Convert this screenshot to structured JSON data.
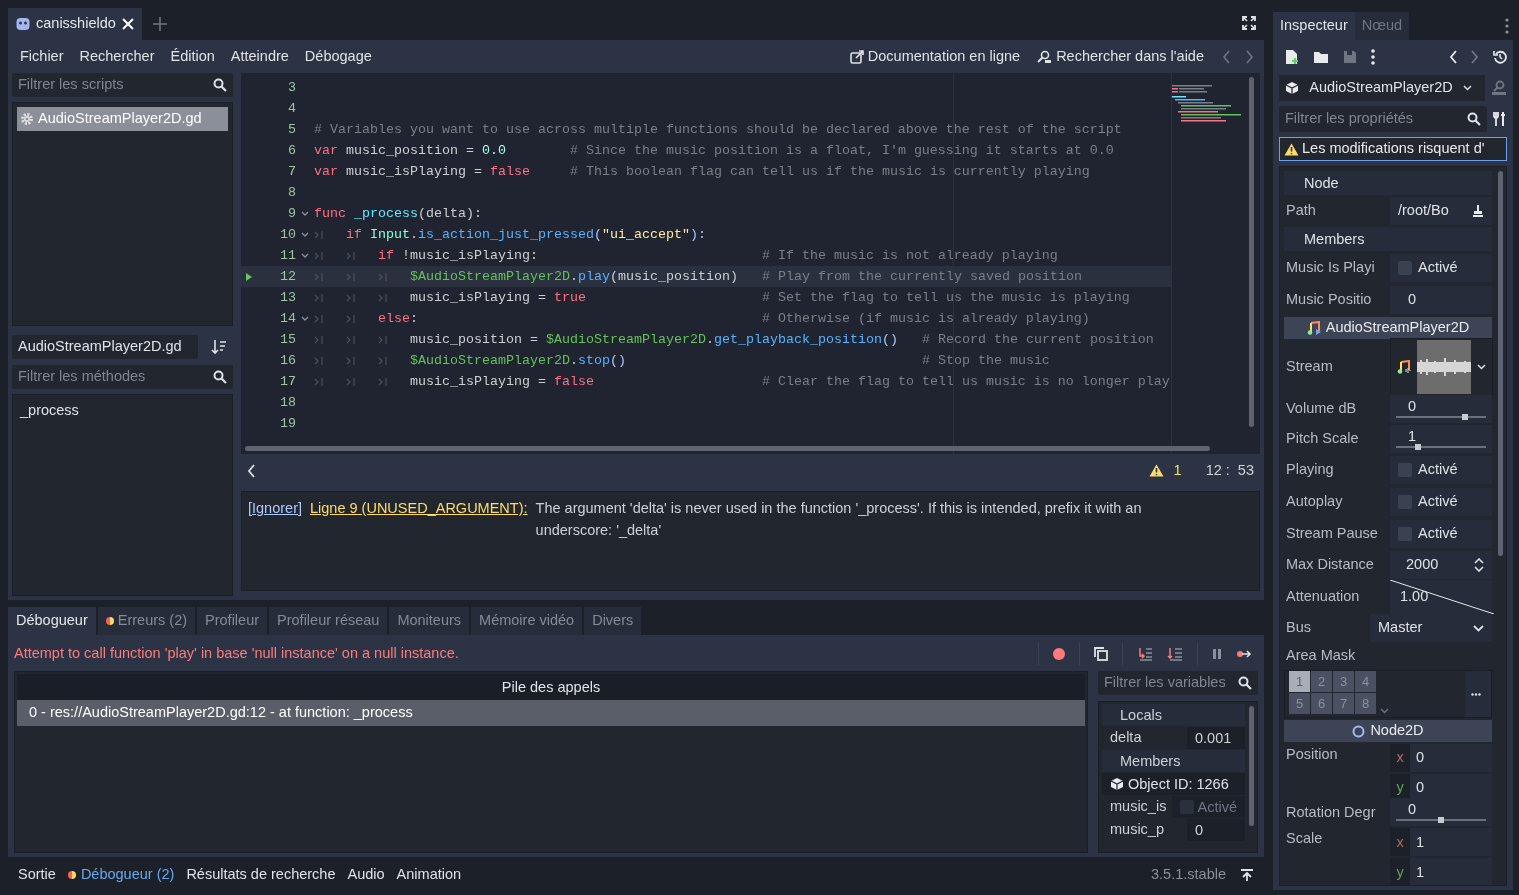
{
  "editor_tabs": [
    {
      "label": "canisshieldo",
      "selected": true
    }
  ],
  "menu": [
    "Fichier",
    "Rechercher",
    "Édition",
    "Atteindre",
    "Débogage"
  ],
  "help_links": [
    "Documentation en ligne",
    "Rechercher dans l'aide"
  ],
  "scripts": {
    "filter_placeholder": "Filtrer les scripts",
    "items": [
      {
        "label": "AudioStreamPlayer2D.gd",
        "selected": true
      }
    ]
  },
  "methods": {
    "script_name": "AudioStreamPlayer2D.gd",
    "filter_placeholder": "Filtrer les méthodes",
    "items": [
      {
        "label": "_process",
        "selected": false
      }
    ]
  },
  "code": {
    "lines": [
      {
        "number": "3",
        "foldable": false,
        "current": false
      },
      {
        "number": "4",
        "foldable": false,
        "current": false
      },
      {
        "number": "5",
        "foldable": false,
        "current": false,
        "tokens": [
          {
            "kind": "comment",
            "text": "# Variables you want to use across multiple functions should be declared above the rest of the script"
          }
        ]
      },
      {
        "number": "6",
        "foldable": false,
        "current": false,
        "tokens": [
          {
            "kind": "keyword",
            "text": "var"
          },
          {
            "kind": "plain",
            "text": " music_position = "
          },
          {
            "kind": "number",
            "text": "0.0"
          },
          {
            "kind": "comment",
            "text": "        # Since the music position is a float, I'm guessing it starts at 0.0"
          }
        ]
      },
      {
        "number": "7",
        "foldable": false,
        "current": false,
        "tokens": [
          {
            "kind": "keyword",
            "text": "var"
          },
          {
            "kind": "plain",
            "text": " music_isPlaying = "
          },
          {
            "kind": "keyword",
            "text": "false"
          },
          {
            "kind": "comment",
            "text": "     # This boolean flag can tell us if the music is currently playing"
          }
        ]
      },
      {
        "number": "8",
        "foldable": false,
        "current": false
      },
      {
        "number": "9",
        "foldable": true,
        "current": false,
        "tokens": [
          {
            "kind": "keyword",
            "text": "func"
          },
          {
            "kind": "define",
            "text": " _process"
          },
          {
            "kind": "plain",
            "text": "(delta):"
          }
        ]
      },
      {
        "number": "10",
        "foldable": true,
        "current": false,
        "tokens": [
          {
            "kind": "tab"
          },
          {
            "kind": "keyword",
            "text": "if"
          },
          {
            "kind": "class",
            "text": " Input"
          },
          {
            "kind": "plain",
            "text": "."
          },
          {
            "kind": "call",
            "text": "is_action_just_pressed"
          },
          {
            "kind": "symbol",
            "text": "("
          },
          {
            "kind": "string",
            "text": "\"ui_accept\""
          },
          {
            "kind": "symbol",
            "text": "):"
          }
        ]
      },
      {
        "number": "11",
        "foldable": true,
        "current": false,
        "tokens": [
          {
            "kind": "tab"
          },
          {
            "kind": "tab"
          },
          {
            "kind": "keyword",
            "text": "if"
          },
          {
            "kind": "plain",
            "text": " !music_isPlaying:"
          },
          {
            "kind": "comment",
            "text": "                            # If the music is not already playing"
          }
        ]
      },
      {
        "number": "12",
        "foldable": false,
        "current": true,
        "tokens": [
          {
            "kind": "tab"
          },
          {
            "kind": "tab"
          },
          {
            "kind": "tab"
          },
          {
            "kind": "node",
            "text": "$AudioStreamPlayer2D"
          },
          {
            "kind": "plain",
            "text": "."
          },
          {
            "kind": "call",
            "text": "play"
          },
          {
            "kind": "plain",
            "text": "(music_position)"
          },
          {
            "kind": "comment",
            "text": "   # Play from the currently saved position"
          }
        ]
      },
      {
        "number": "13",
        "foldable": false,
        "current": false,
        "tokens": [
          {
            "kind": "tab"
          },
          {
            "kind": "tab"
          },
          {
            "kind": "tab"
          },
          {
            "kind": "plain",
            "text": "music_isPlaying = "
          },
          {
            "kind": "keyword",
            "text": "true"
          },
          {
            "kind": "comment",
            "text": "                      # Set the flag to tell us the music is playing"
          }
        ]
      },
      {
        "number": "14",
        "foldable": true,
        "current": false,
        "tokens": [
          {
            "kind": "tab"
          },
          {
            "kind": "tab"
          },
          {
            "kind": "keyword",
            "text": "else"
          },
          {
            "kind": "plain",
            "text": ":"
          },
          {
            "kind": "comment",
            "text": "                                           # Otherwise (if music is already playing)"
          }
        ]
      },
      {
        "number": "15",
        "foldable": false,
        "current": false,
        "tokens": [
          {
            "kind": "tab"
          },
          {
            "kind": "tab"
          },
          {
            "kind": "tab"
          },
          {
            "kind": "plain",
            "text": "music_position = "
          },
          {
            "kind": "node",
            "text": "$AudioStreamPlayer2D"
          },
          {
            "kind": "plain",
            "text": "."
          },
          {
            "kind": "call",
            "text": "get_playback_position"
          },
          {
            "kind": "symbol",
            "text": "()"
          },
          {
            "kind": "comment",
            "text": "   # Record the current position"
          }
        ]
      },
      {
        "number": "16",
        "foldable": false,
        "current": false,
        "tokens": [
          {
            "kind": "tab"
          },
          {
            "kind": "tab"
          },
          {
            "kind": "tab"
          },
          {
            "kind": "node",
            "text": "$AudioStreamPlayer2D"
          },
          {
            "kind": "plain",
            "text": "."
          },
          {
            "kind": "call",
            "text": "stop"
          },
          {
            "kind": "symbol",
            "text": "()"
          },
          {
            "kind": "comment",
            "text": "                                     # Stop the music"
          }
        ]
      },
      {
        "number": "17",
        "foldable": false,
        "current": false,
        "tokens": [
          {
            "kind": "tab"
          },
          {
            "kind": "tab"
          },
          {
            "kind": "tab"
          },
          {
            "kind": "plain",
            "text": "music_isPlaying = "
          },
          {
            "kind": "keyword",
            "text": "false"
          },
          {
            "kind": "comment",
            "text": "                     # Clear the flag to tell us music is no longer play"
          }
        ]
      },
      {
        "number": "18",
        "foldable": false,
        "current": false
      },
      {
        "number": "19",
        "foldable": false,
        "current": false
      }
    ]
  },
  "status": {
    "warning_count": "1",
    "cursor": "12 :  53"
  },
  "warnings": [
    {
      "ignore": "[Ignorer]",
      "location": "Ligne 9 (UNUSED_ARGUMENT):",
      "message": "The argument 'delta' is never used in the function '_process'. If this is intended, prefix it with an underscore: '_delta'"
    }
  ],
  "debugger": {
    "tabs": [
      {
        "label": "Débogueur",
        "selected": true,
        "alert": false
      },
      {
        "label": "Erreurs (2)",
        "selected": false,
        "alert": true
      },
      {
        "label": "Profileur",
        "selected": false,
        "alert": false
      },
      {
        "label": "Profileur réseau",
        "selected": false,
        "alert": false
      },
      {
        "label": "Moniteurs",
        "selected": false,
        "alert": false
      },
      {
        "label": "Mémoire vidéo",
        "selected": false,
        "alert": false
      },
      {
        "label": "Divers",
        "selected": false,
        "alert": false
      }
    ],
    "error_message": "Attempt to call function 'play' in base 'null instance' on a null instance.",
    "stack": {
      "title": "Pile des appels",
      "frames": [
        {
          "label": "0 - res://AudioStreamPlayer2D.gd:12 - at function: _process",
          "selected": true
        }
      ]
    },
    "variables": {
      "filter_placeholder": "Filtrer les variables",
      "rows": [
        {
          "kind": "section",
          "label": "Locals"
        },
        {
          "kind": "value",
          "label": "delta",
          "value": "0.001"
        },
        {
          "kind": "section",
          "label": "Members"
        },
        {
          "kind": "object",
          "label": "Object ID: 1266"
        },
        {
          "kind": "checkbox",
          "label": "music_is",
          "value": "Activé",
          "checked": false
        },
        {
          "kind": "value",
          "label": "music_p",
          "value": "0"
        }
      ]
    }
  },
  "bottom_tabs": [
    {
      "label": "Sortie",
      "selected": false,
      "alert": false
    },
    {
      "label": "Débogueur (2)",
      "selected": true,
      "alert": true
    },
    {
      "label": "Résultats de recherche",
      "selected": false,
      "alert": false
    },
    {
      "label": "Audio",
      "selected": false,
      "alert": false
    },
    {
      "label": "Animation",
      "selected": false,
      "alert": false
    }
  ],
  "version": "3.5.1.stable",
  "inspector": {
    "tabs": [
      {
        "label": "Inspecteur",
        "selected": true
      },
      {
        "label": "Nœud",
        "selected": false
      }
    ],
    "object": "AudioStreamPlayer2D",
    "filter_placeholder": "Filtrer les propriétés",
    "warning": "Les modifications risquent d'",
    "properties": [
      {
        "kind": "section",
        "label": "Node"
      },
      {
        "kind": "path",
        "label": "Path",
        "value": "/root/Bo"
      },
      {
        "kind": "section",
        "label": "Members"
      },
      {
        "kind": "checkbox",
        "label": "Music Is Playi",
        "value": "Activé",
        "checked": false
      },
      {
        "kind": "text",
        "label": "Music Positio",
        "value": "0"
      },
      {
        "kind": "category",
        "label": "AudioStreamPlayer2D"
      },
      {
        "kind": "resource",
        "label": "Stream"
      },
      {
        "kind": "slider",
        "label": "Volume dB",
        "value": "0",
        "level": 0.77
      },
      {
        "kind": "slider",
        "label": "Pitch Scale",
        "value": "1",
        "level": 0.24
      },
      {
        "kind": "checkbox",
        "label": "Playing",
        "value": "Activé",
        "checked": false
      },
      {
        "kind": "checkbox",
        "label": "Autoplay",
        "value": "Activé",
        "checked": false
      },
      {
        "kind": "checkbox",
        "label": "Stream Pause",
        "value": "Activé",
        "checked": false
      },
      {
        "kind": "spin",
        "label": "Max Distance",
        "value": "2000"
      },
      {
        "kind": "curve",
        "label": "Attenuation",
        "value": "1.00"
      },
      {
        "kind": "dropdown",
        "label": "Bus",
        "value": "Master"
      },
      {
        "kind": "layers",
        "label": "Area Mask",
        "layers": [
          {
            "label": "1",
            "selected": true
          },
          {
            "label": "2",
            "selected": false
          },
          {
            "label": "3",
            "selected": false
          },
          {
            "label": "4",
            "selected": false
          },
          {
            "label": "5",
            "selected": false
          },
          {
            "label": "6",
            "selected": false
          },
          {
            "label": "7",
            "selected": false
          },
          {
            "label": "8",
            "selected": false
          }
        ]
      },
      {
        "kind": "category",
        "label": "Node2D"
      },
      {
        "kind": "vector",
        "label": "Position",
        "components": [
          {
            "axis": "x",
            "value": "0"
          },
          {
            "axis": "y",
            "value": "0"
          }
        ]
      },
      {
        "kind": "slider",
        "label": "Rotation Degr",
        "value": "0",
        "level": 0.5
      },
      {
        "kind": "vector",
        "label": "Scale",
        "components": [
          {
            "axis": "x",
            "value": "1"
          },
          {
            "axis": "y",
            "value": "1"
          }
        ]
      }
    ]
  }
}
